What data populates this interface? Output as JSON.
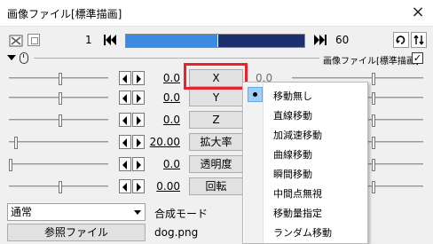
{
  "window": {
    "title": "画像ファイル[標準描画]",
    "close_glyph": "×"
  },
  "timeline": {
    "start_frame": "1",
    "end_frame": "60",
    "current_fraction": 0.51
  },
  "object": {
    "name": "画像ファイル[標準描画]",
    "enabled_glyph": "✓"
  },
  "params": [
    {
      "label": "X",
      "value": "0.0",
      "right_value": "0.0",
      "slider_fraction": 0.5,
      "highlighted": true
    },
    {
      "label": "Y",
      "value": "0.0",
      "slider_fraction": 0.5
    },
    {
      "label": "Z",
      "value": "0.0",
      "slider_fraction": 0.5
    },
    {
      "label": "拡大率",
      "value": "20.00",
      "slider_fraction": 0.05
    },
    {
      "label": "透明度",
      "value": "0.0",
      "slider_fraction": 0.0
    },
    {
      "label": "回転",
      "value": "0.00",
      "slider_fraction": 0.5
    }
  ],
  "blend": {
    "selected": "通常",
    "label": "合成モード"
  },
  "reference": {
    "button_label": "参照ファイル",
    "file_name": "dog.png"
  },
  "menu": {
    "items": [
      {
        "label": "移動無し",
        "checked": true
      },
      {
        "label": "直線移動"
      },
      {
        "label": "加減速移動"
      },
      {
        "label": "曲線移動"
      },
      {
        "label": "瞬間移動"
      },
      {
        "label": "中間点無視"
      },
      {
        "label": "移動量指定"
      },
      {
        "label": "ランダム移動"
      }
    ]
  },
  "icons": [
    "frame-icon",
    "panel-icon",
    "skip-start-icon",
    "skip-end-icon",
    "redo-icon",
    "settings-icon",
    "collapse-icon",
    "mouse-icon",
    "arrow-left-icon",
    "arrow-right-icon"
  ],
  "colors": {
    "accent": "#3d8be0",
    "seek_bg": "#1c2f6e",
    "highlight_box": "#e8232b",
    "menu_check": "#9ed0ff"
  }
}
